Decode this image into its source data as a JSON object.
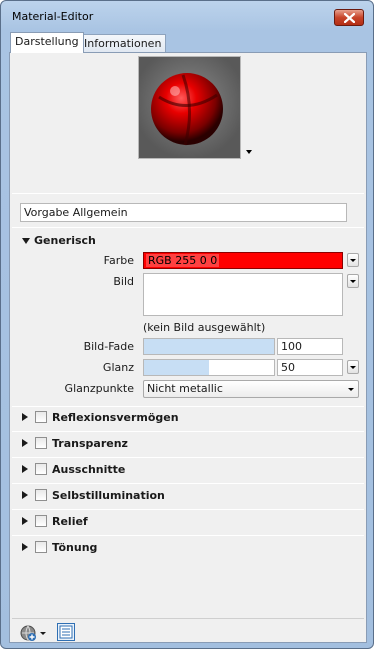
{
  "window": {
    "title": "Material-Editor"
  },
  "tabs": [
    {
      "label": "Darstellung",
      "active": true
    },
    {
      "label": "Informationen",
      "active": false
    }
  ],
  "preset": {
    "value": "Vorgabe Allgemein"
  },
  "generic": {
    "header": "Generisch",
    "color_label": "Farbe",
    "color_value": "RGB 255 0 0",
    "color_hex": "#ff0000",
    "image_label": "Bild",
    "no_image": "(kein Bild ausgewählt)",
    "fade_label": "Bild-Fade",
    "fade_value": "100",
    "fade_level": 1.0,
    "gloss_label": "Glanz",
    "gloss_value": "50",
    "gloss_level": 0.5,
    "highlights_label": "Glanzpunkte",
    "highlights_value": "Nicht metallic"
  },
  "categories": [
    {
      "label": "Reflexionsvermögen",
      "checked": false
    },
    {
      "label": "Transparenz",
      "checked": false
    },
    {
      "label": "Ausschnitte",
      "checked": false
    },
    {
      "label": "Selbstillumination",
      "checked": false
    },
    {
      "label": "Relief",
      "checked": false
    },
    {
      "label": "Tönung",
      "checked": false
    }
  ],
  "icons": {
    "close": "close-icon",
    "preview_menu": "chevron-down-icon",
    "globe": "globe-add-icon",
    "list": "list-view-icon"
  }
}
